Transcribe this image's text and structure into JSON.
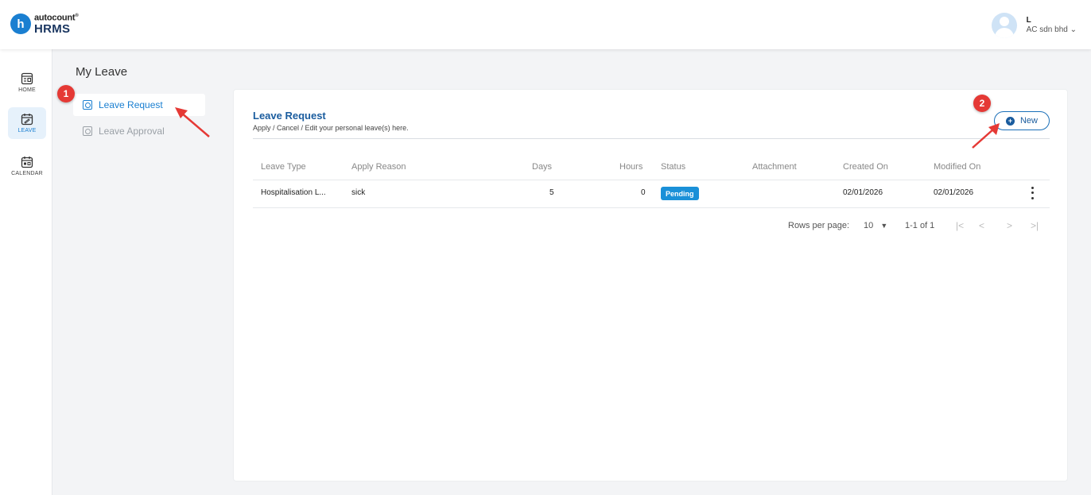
{
  "brand": {
    "top": "autocount",
    "bottom": "HRMS",
    "mark": "h",
    "color": "#1a7fd1"
  },
  "user": {
    "name": "L",
    "company": "AC sdn bhd"
  },
  "rail": [
    {
      "label": "HOME",
      "icon": "home-icon"
    },
    {
      "label": "LEAVE",
      "icon": "leave-icon"
    },
    {
      "label": "CALENDAR",
      "icon": "calendar-icon"
    }
  ],
  "page": {
    "title": "My Leave"
  },
  "subnav": [
    {
      "label": "Leave Request"
    },
    {
      "label": "Leave Approval"
    }
  ],
  "card": {
    "title": "Leave Request",
    "subtitle": "Apply / Cancel / Edit your personal leave(s) here.",
    "new_label": "New"
  },
  "table": {
    "headers": [
      "Leave Type",
      "Apply Reason",
      "Days",
      "Hours",
      "Status",
      "Attachment",
      "Created On",
      "Modified On"
    ],
    "rows": [
      {
        "leave_type": "Hospitalisation L...",
        "reason": "sick",
        "days": "5",
        "hours": "0",
        "status": "Pending",
        "attachment": "",
        "created": "02/01/2026",
        "modified": "02/01/2026"
      }
    ]
  },
  "pagination": {
    "rows_label": "Rows per page:",
    "rows_value": "10",
    "range": "1-1 of 1"
  },
  "annotations": {
    "marker1": "1",
    "marker2": "2",
    "color": "#e53935"
  },
  "status_color": "#1a90d8"
}
